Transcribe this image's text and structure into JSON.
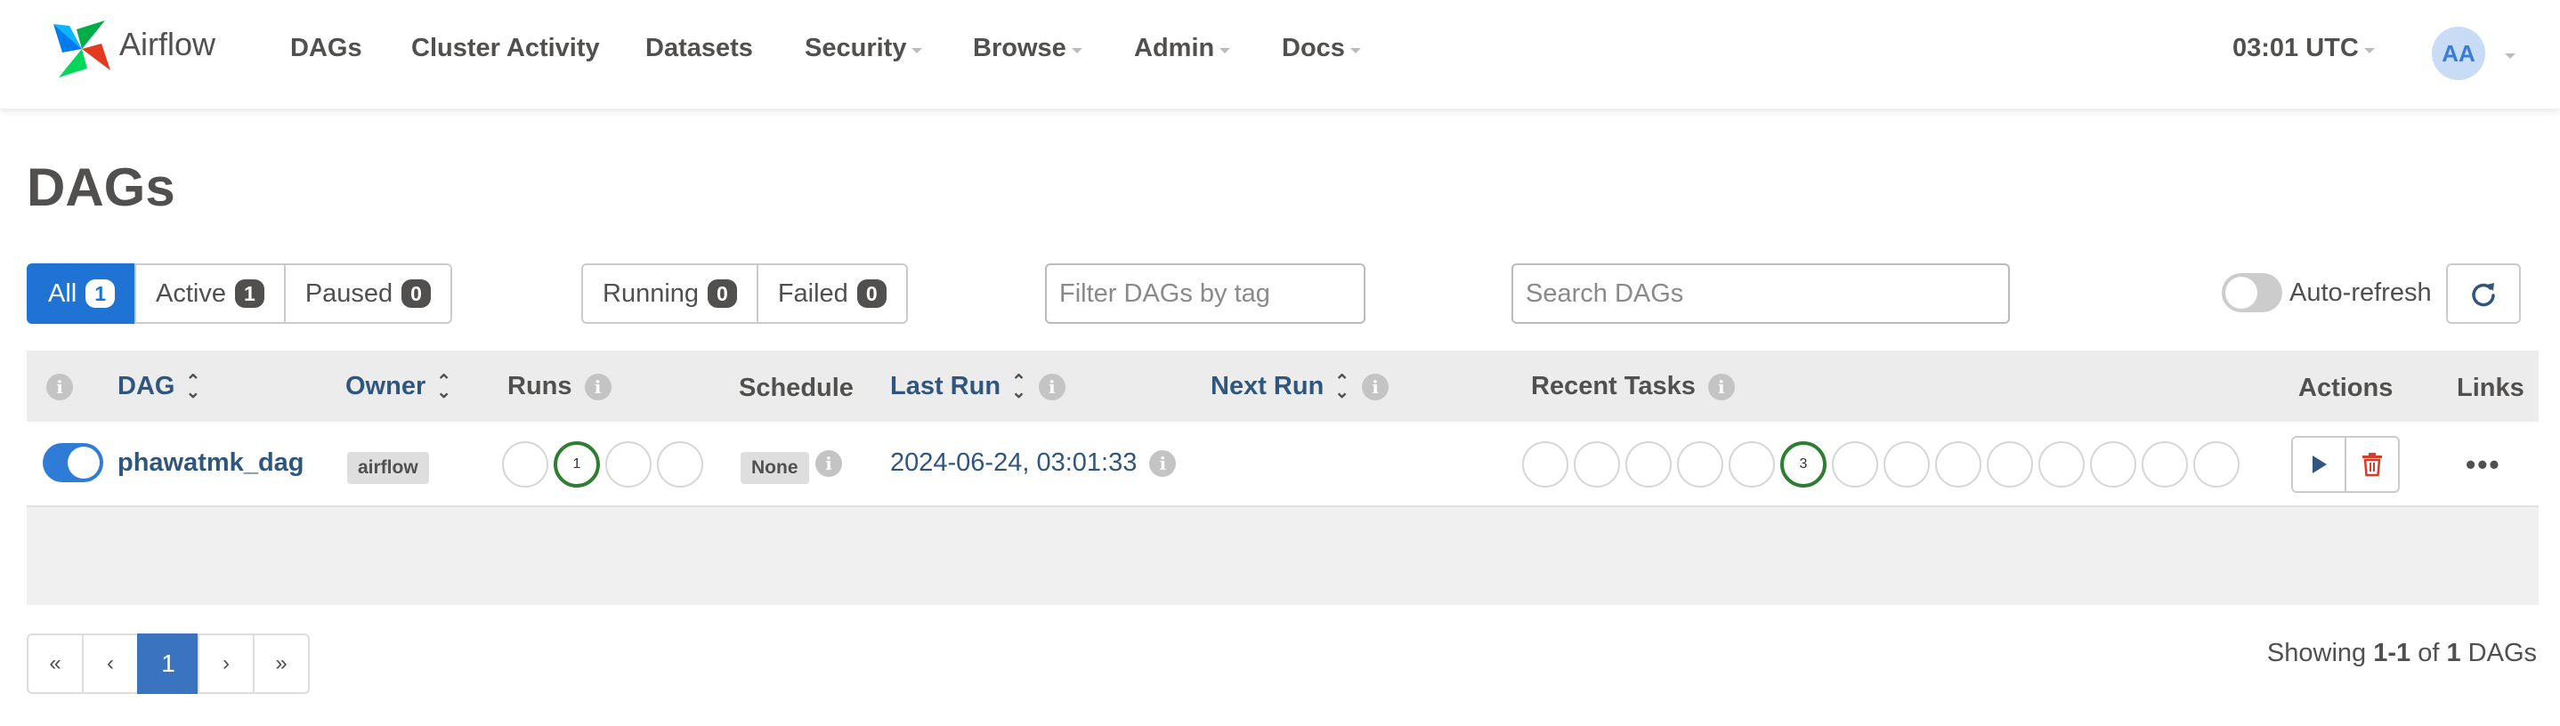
{
  "navbar": {
    "brand": "Airflow",
    "items": [
      {
        "label": "DAGs",
        "dropdown": false
      },
      {
        "label": "Cluster Activity",
        "dropdown": false
      },
      {
        "label": "Datasets",
        "dropdown": false
      },
      {
        "label": "Security",
        "dropdown": true
      },
      {
        "label": "Browse",
        "dropdown": true
      },
      {
        "label": "Admin",
        "dropdown": true
      },
      {
        "label": "Docs",
        "dropdown": true
      }
    ],
    "clock": "03:01 UTC",
    "avatar": "AA"
  },
  "page_title": "DAGs",
  "filters": {
    "status": [
      {
        "label": "All",
        "count": "1",
        "active": true
      },
      {
        "label": "Active",
        "count": "1",
        "active": false
      },
      {
        "label": "Paused",
        "count": "0",
        "active": false
      }
    ],
    "state": [
      {
        "label": "Running",
        "count": "0"
      },
      {
        "label": "Failed",
        "count": "0"
      }
    ],
    "tag_placeholder": "Filter DAGs by tag",
    "search_placeholder": "Search DAGs",
    "auto_refresh_label": "Auto-refresh"
  },
  "table": {
    "headers": {
      "dag": "DAG",
      "owner": "Owner",
      "runs": "Runs",
      "schedule": "Schedule",
      "last_run": "Last Run",
      "next_run": "Next Run",
      "recent_tasks": "Recent Tasks",
      "actions": "Actions",
      "links": "Links"
    },
    "rows": [
      {
        "dag_id": "phawatmk_dag",
        "owner": "airflow",
        "runs_success_count": "1",
        "schedule": "None",
        "last_run": "2024-06-24, 03:01:33",
        "next_run": "",
        "recent_tasks_success_count": "3",
        "paused": false
      }
    ]
  },
  "pagination": {
    "first": "«",
    "prev": "‹",
    "current": "1",
    "next": "›",
    "last": "»"
  },
  "showing": {
    "prefix": "Showing",
    "range": "1-1",
    "of": "of",
    "total": "1",
    "suffix": "DAGs"
  },
  "colors": {
    "primary": "#1f73d4",
    "success": "#2e7d32",
    "danger": "#d43d2a",
    "link": "#30567d"
  }
}
